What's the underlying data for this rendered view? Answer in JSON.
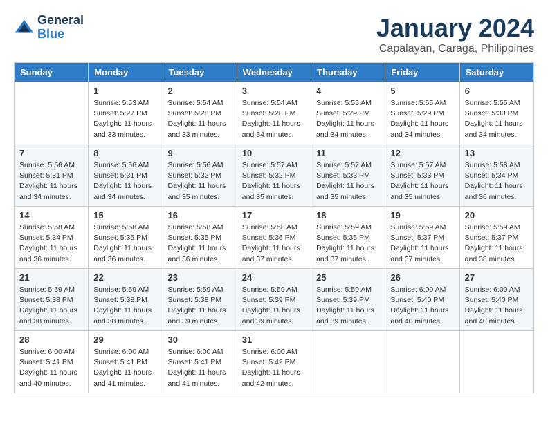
{
  "header": {
    "logo_general": "General",
    "logo_blue": "Blue",
    "month_title": "January 2024",
    "location": "Capalayan, Caraga, Philippines"
  },
  "weekdays": [
    "Sunday",
    "Monday",
    "Tuesday",
    "Wednesday",
    "Thursday",
    "Friday",
    "Saturday"
  ],
  "weeks": [
    [
      {
        "day": "",
        "info": ""
      },
      {
        "day": "1",
        "info": "Sunrise: 5:53 AM\nSunset: 5:27 PM\nDaylight: 11 hours\nand 33 minutes."
      },
      {
        "day": "2",
        "info": "Sunrise: 5:54 AM\nSunset: 5:28 PM\nDaylight: 11 hours\nand 33 minutes."
      },
      {
        "day": "3",
        "info": "Sunrise: 5:54 AM\nSunset: 5:28 PM\nDaylight: 11 hours\nand 34 minutes."
      },
      {
        "day": "4",
        "info": "Sunrise: 5:55 AM\nSunset: 5:29 PM\nDaylight: 11 hours\nand 34 minutes."
      },
      {
        "day": "5",
        "info": "Sunrise: 5:55 AM\nSunset: 5:29 PM\nDaylight: 11 hours\nand 34 minutes."
      },
      {
        "day": "6",
        "info": "Sunrise: 5:55 AM\nSunset: 5:30 PM\nDaylight: 11 hours\nand 34 minutes."
      }
    ],
    [
      {
        "day": "7",
        "info": "Sunrise: 5:56 AM\nSunset: 5:31 PM\nDaylight: 11 hours\nand 34 minutes."
      },
      {
        "day": "8",
        "info": "Sunrise: 5:56 AM\nSunset: 5:31 PM\nDaylight: 11 hours\nand 34 minutes."
      },
      {
        "day": "9",
        "info": "Sunrise: 5:56 AM\nSunset: 5:32 PM\nDaylight: 11 hours\nand 35 minutes."
      },
      {
        "day": "10",
        "info": "Sunrise: 5:57 AM\nSunset: 5:32 PM\nDaylight: 11 hours\nand 35 minutes."
      },
      {
        "day": "11",
        "info": "Sunrise: 5:57 AM\nSunset: 5:33 PM\nDaylight: 11 hours\nand 35 minutes."
      },
      {
        "day": "12",
        "info": "Sunrise: 5:57 AM\nSunset: 5:33 PM\nDaylight: 11 hours\nand 35 minutes."
      },
      {
        "day": "13",
        "info": "Sunrise: 5:58 AM\nSunset: 5:34 PM\nDaylight: 11 hours\nand 36 minutes."
      }
    ],
    [
      {
        "day": "14",
        "info": "Sunrise: 5:58 AM\nSunset: 5:34 PM\nDaylight: 11 hours\nand 36 minutes."
      },
      {
        "day": "15",
        "info": "Sunrise: 5:58 AM\nSunset: 5:35 PM\nDaylight: 11 hours\nand 36 minutes."
      },
      {
        "day": "16",
        "info": "Sunrise: 5:58 AM\nSunset: 5:35 PM\nDaylight: 11 hours\nand 36 minutes."
      },
      {
        "day": "17",
        "info": "Sunrise: 5:58 AM\nSunset: 5:36 PM\nDaylight: 11 hours\nand 37 minutes."
      },
      {
        "day": "18",
        "info": "Sunrise: 5:59 AM\nSunset: 5:36 PM\nDaylight: 11 hours\nand 37 minutes."
      },
      {
        "day": "19",
        "info": "Sunrise: 5:59 AM\nSunset: 5:37 PM\nDaylight: 11 hours\nand 37 minutes."
      },
      {
        "day": "20",
        "info": "Sunrise: 5:59 AM\nSunset: 5:37 PM\nDaylight: 11 hours\nand 38 minutes."
      }
    ],
    [
      {
        "day": "21",
        "info": "Sunrise: 5:59 AM\nSunset: 5:38 PM\nDaylight: 11 hours\nand 38 minutes."
      },
      {
        "day": "22",
        "info": "Sunrise: 5:59 AM\nSunset: 5:38 PM\nDaylight: 11 hours\nand 38 minutes."
      },
      {
        "day": "23",
        "info": "Sunrise: 5:59 AM\nSunset: 5:38 PM\nDaylight: 11 hours\nand 39 minutes."
      },
      {
        "day": "24",
        "info": "Sunrise: 5:59 AM\nSunset: 5:39 PM\nDaylight: 11 hours\nand 39 minutes."
      },
      {
        "day": "25",
        "info": "Sunrise: 5:59 AM\nSunset: 5:39 PM\nDaylight: 11 hours\nand 39 minutes."
      },
      {
        "day": "26",
        "info": "Sunrise: 6:00 AM\nSunset: 5:40 PM\nDaylight: 11 hours\nand 40 minutes."
      },
      {
        "day": "27",
        "info": "Sunrise: 6:00 AM\nSunset: 5:40 PM\nDaylight: 11 hours\nand 40 minutes."
      }
    ],
    [
      {
        "day": "28",
        "info": "Sunrise: 6:00 AM\nSunset: 5:41 PM\nDaylight: 11 hours\nand 40 minutes."
      },
      {
        "day": "29",
        "info": "Sunrise: 6:00 AM\nSunset: 5:41 PM\nDaylight: 11 hours\nand 41 minutes."
      },
      {
        "day": "30",
        "info": "Sunrise: 6:00 AM\nSunset: 5:41 PM\nDaylight: 11 hours\nand 41 minutes."
      },
      {
        "day": "31",
        "info": "Sunrise: 6:00 AM\nSunset: 5:42 PM\nDaylight: 11 hours\nand 42 minutes."
      },
      {
        "day": "",
        "info": ""
      },
      {
        "day": "",
        "info": ""
      },
      {
        "day": "",
        "info": ""
      }
    ]
  ]
}
